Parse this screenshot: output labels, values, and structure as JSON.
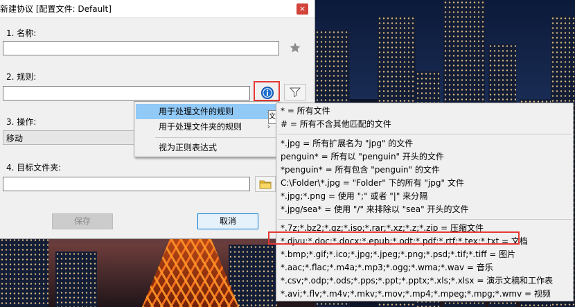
{
  "dialog": {
    "title": "新建协议 [配置文件: Default]",
    "close_glyph": "×",
    "name_label": "1. 名称:",
    "name_value": "",
    "rule_label": "2. 规则:",
    "rule_value": "",
    "action_label": "3. 操作:",
    "action_value": "移动",
    "target_label": "4. 目标文件夹:",
    "target_value": "",
    "save_label": "保存",
    "cancel_label": "取消"
  },
  "icons": {
    "favorite": "star-icon",
    "info": "info-icon",
    "filter": "filter-icon",
    "folder": "folder-icon"
  },
  "context_menu": {
    "items": [
      {
        "label": "用于处理文件的规则",
        "has_submenu": true,
        "highlighted": true
      },
      {
        "label": "用于处理文件夹的规则",
        "has_submenu": true,
        "highlighted": false
      },
      {
        "label": "视为正则表达式",
        "has_submenu": false,
        "highlighted": false
      }
    ]
  },
  "submenu": {
    "group1": [
      "* = 所有文件",
      "# = 所有不含其他匹配的文件"
    ],
    "group2": [
      "*.jpg = 所有扩展名为 \"jpg\" 的文件",
      "penguin* = 所有以 \"penguin\" 开头的文件",
      "*penguin* = 所有包含 \"penguin\" 的文件",
      "C:\\Folder\\*.jpg = \"Folder\" 下的所有 \"jpg\" 文件",
      "*.jpg;*.png = 使用 \";\" 或者 \"|\" 来分隔",
      "*.jpg/sea* = 使用 \"/\" 来排除以 \"sea\" 开头的文件"
    ],
    "group3": [
      "*.7z;*.bz2;*.gz;*.iso;*.rar;*.xz;*.z;*.zip = 压缩文件",
      "*.djvu;*.doc;*.docx;*.epub;*.odt;*.pdf;*.rtf;*.tex;*.txt = 文档",
      "*.bmp;*.gif;*.ico;*.jpg;*.jpeg;*.png;*.psd;*.tif;*.tiff = 图片",
      "*.aac;*.flac;*.m4a;*.mp3;*.ogg;*.wma;*.wav = 音乐",
      "*.csv;*.odp;*.ods;*.pps;*.ppt;*.pptx;*.xls;*.xlsx = 演示文稿和工作表",
      "*.avi;*.flv;*.m4v;*.mkv;*.mov;*.mp4;*.mpeg;*.mpg;*.wmv = 视频"
    ],
    "tooltip_fragment": "文"
  },
  "colors": {
    "highlight": "#91c9f7",
    "annotation_red": "#e53935",
    "close_red": "#d2433a",
    "info_blue": "#1e6fd0"
  }
}
